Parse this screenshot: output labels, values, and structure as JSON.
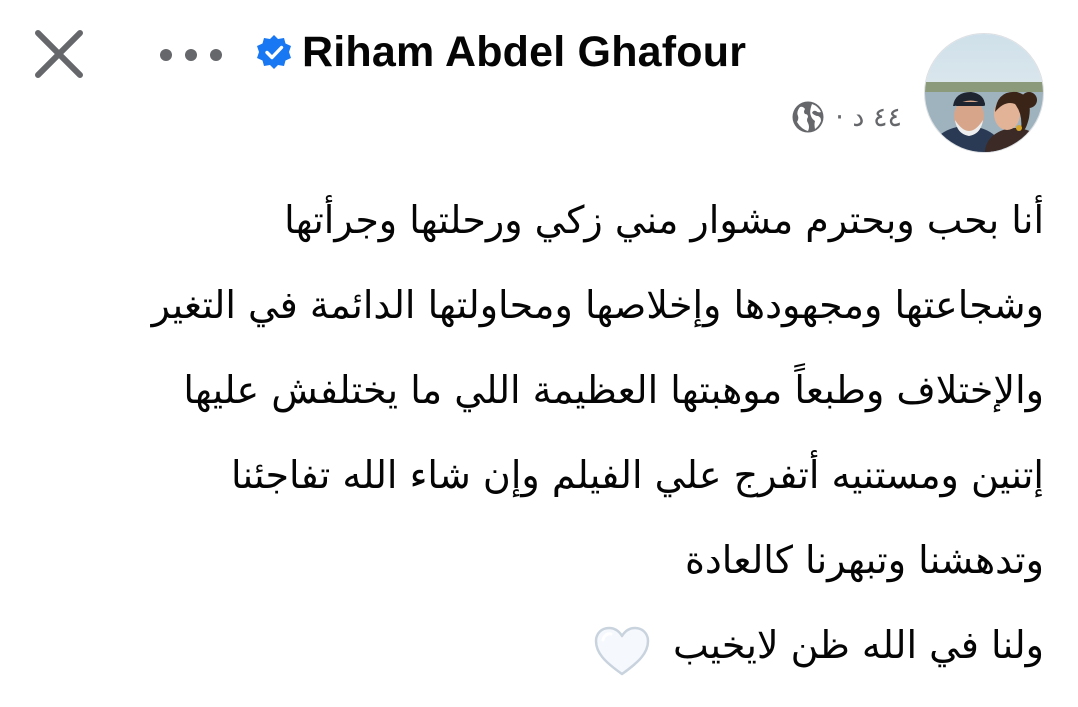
{
  "header": {
    "author": "Riham Abdel Ghafour",
    "timestamp": "٤٤ د ·",
    "privacy_icon": "globe-icon",
    "close_icon": "close-icon",
    "more_icon": "more-options-icon",
    "verified_icon": "verified-badge-icon"
  },
  "post": {
    "lines": [
      "أنا بحب وبحترم مشوار مني زكي ورحلتها وجرأتها",
      "وشجاعتها ومجهودها وإخلاصها ومحاولتها الدائمة في التغير",
      "والإختلاف وطبعاً موهبتها العظيمة اللي ما يختلفش عليها",
      "إتنين  ومستنيه أتفرج علي الفيلم وإن شاء الله تفاجئنا",
      "وتدهشنا وتبهرنا كالعادة",
      "ولنا في الله ظن لايخيب"
    ],
    "emoji": "white-heart-emoji"
  },
  "colors": {
    "text": "#050505",
    "secondary": "#65676b",
    "verified_blue": "#1877f2"
  }
}
